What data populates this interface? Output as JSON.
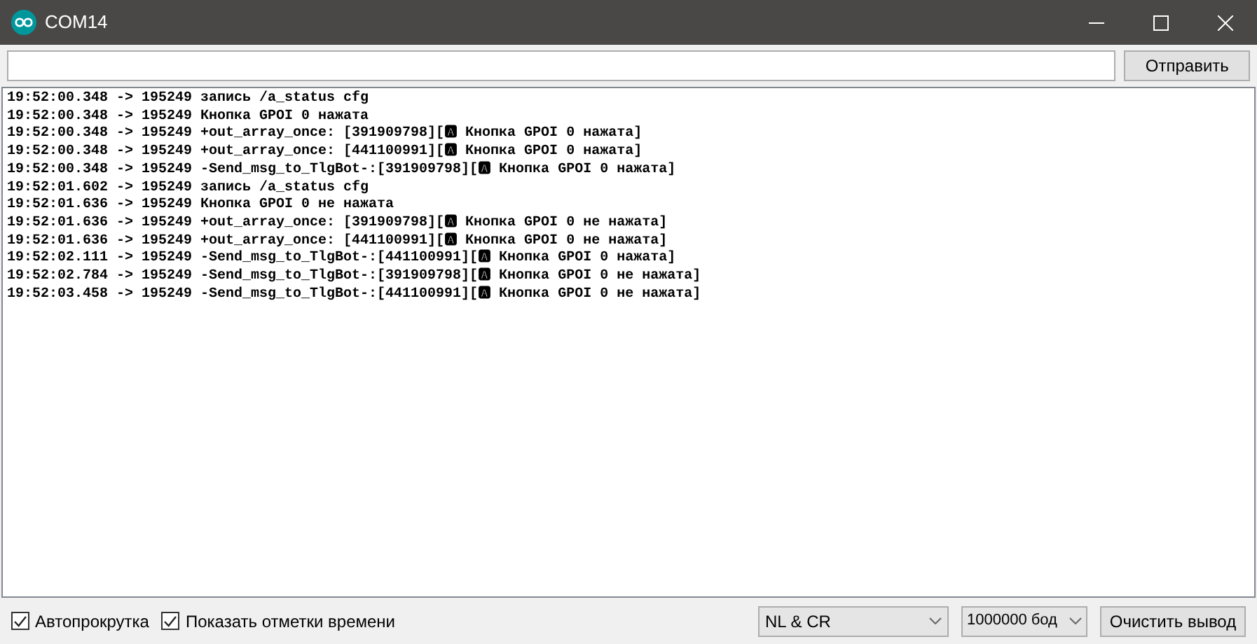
{
  "window": {
    "title": "COM14"
  },
  "send_button": "Отправить",
  "log_lines": [
    "19:52:00.348 -> 195249 запись /a_status cfg",
    "19:52:00.348 -> 195249 Кнопка GPOI 0 нажата",
    "19:52:00.348 -> 195249 +out_array_once: [391909798][🅰 Кнопка GPOI 0 нажата]",
    "19:52:00.348 -> 195249 +out_array_once: [441100991][🅰 Кнопка GPOI 0 нажата]",
    "19:52:00.348 -> 195249 -Send_msg_to_TlgBot-:[391909798][🅰 Кнопка GPOI 0 нажата]",
    "19:52:01.602 -> 195249 запись /a_status cfg",
    "19:52:01.636 -> 195249 Кнопка GPOI 0 не нажата",
    "19:52:01.636 -> 195249 +out_array_once: [391909798][🅰 Кнопка GPOI 0 не нажата]",
    "19:52:01.636 -> 195249 +out_array_once: [441100991][🅰 Кнопка GPOI 0 не нажата]",
    "19:52:02.111 -> 195249 -Send_msg_to_TlgBot-:[441100991][🅰 Кнопка GPOI 0 нажата]",
    "19:52:02.784 -> 195249 -Send_msg_to_TlgBot-:[391909798][🅰 Кнопка GPOI 0 не нажата]",
    "19:52:03.458 -> 195249 -Send_msg_to_TlgBot-:[441100991][🅰 Кнопка GPOI 0 не нажата]"
  ],
  "options": [
    {
      "label": "Автопрокрутка",
      "checked": true
    },
    {
      "label": "Показать отметки времени",
      "checked": true
    }
  ],
  "line_ending": "NL & CR",
  "baud_rate": "1000000 бод",
  "clear_button": "Очистить вывод"
}
